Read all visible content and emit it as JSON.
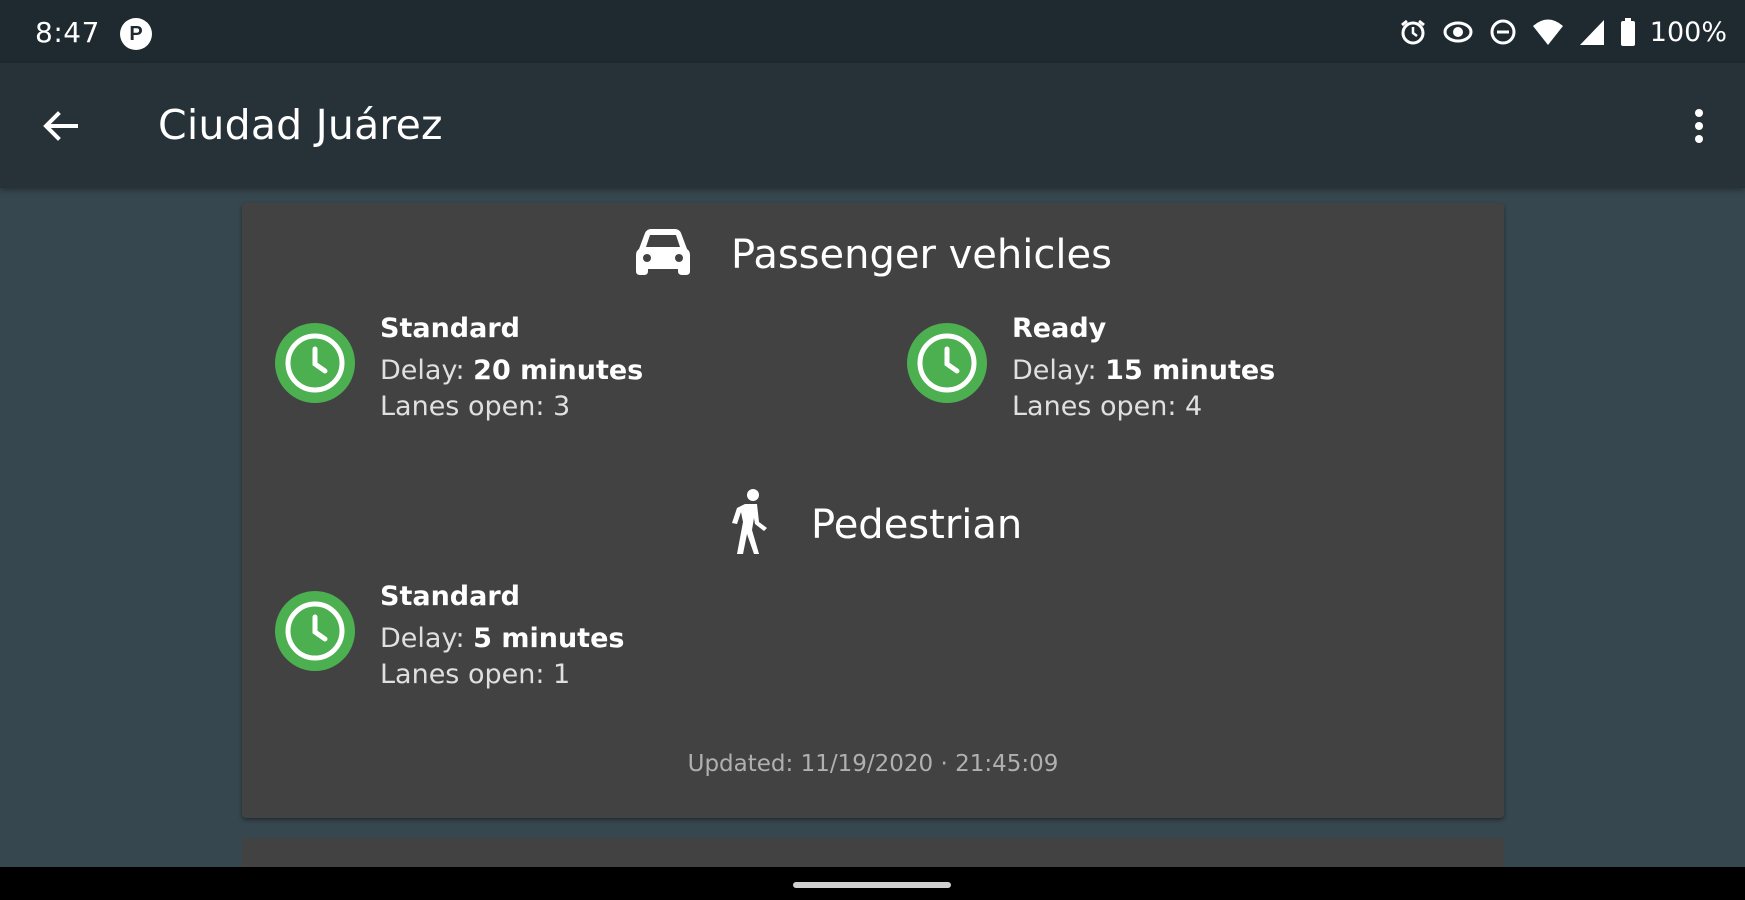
{
  "status_bar": {
    "time": "8:47",
    "app_icon_letter": "P",
    "battery": "100%",
    "icons": [
      "alarm-icon",
      "data-saver-icon",
      "do-not-disturb-icon",
      "wifi-icon",
      "cell-signal-icon",
      "battery-icon"
    ]
  },
  "app_bar": {
    "title": "Ciudad Juárez"
  },
  "card": {
    "passenger": {
      "title": "Passenger vehicles",
      "icon": "car-icon",
      "lanes": [
        {
          "type": "Standard",
          "delay_label": "Delay: ",
          "delay_value": "20 minutes",
          "lanes_open": "Lanes open: 3"
        },
        {
          "type": "Ready",
          "delay_label": "Delay: ",
          "delay_value": "15 minutes",
          "lanes_open": "Lanes open: 4"
        }
      ]
    },
    "pedestrian": {
      "title": "Pedestrian",
      "icon": "pedestrian-icon",
      "lanes": [
        {
          "type": "Standard",
          "delay_label": "Delay: ",
          "delay_value": "5 minutes",
          "lanes_open": "Lanes open: 1"
        }
      ]
    },
    "updated": "Updated: 11/19/2020 · 21:45:09"
  },
  "colors": {
    "status_bar": "#1f2a30",
    "app_bar": "#263238",
    "background": "#37474f",
    "card": "#424242",
    "status_green": "#4caf50"
  }
}
